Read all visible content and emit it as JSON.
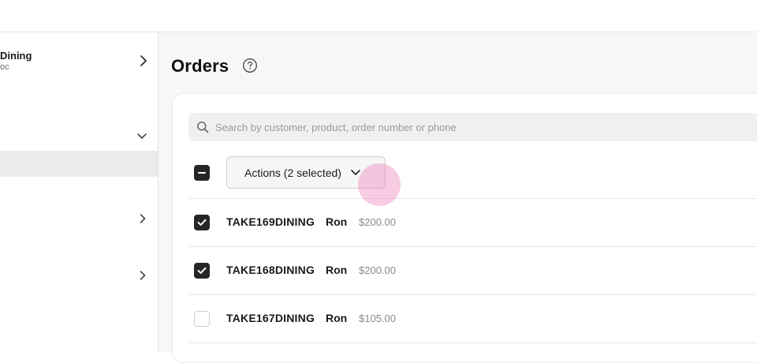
{
  "sidebar": {
    "store_name": "Dining",
    "store_sub": "oc"
  },
  "main": {
    "title": "Orders",
    "search": {
      "placeholder": "Search by customer, product, order number or phone",
      "value": ""
    },
    "actions_label": "Actions (2 selected)",
    "orders": [
      {
        "number": "TAKE169DINING",
        "customer": "Ron",
        "amount": "$200.00",
        "checked": true
      },
      {
        "number": "TAKE168DINING",
        "customer": "Ron",
        "amount": "$200.00",
        "checked": true
      },
      {
        "number": "TAKE167DINING",
        "customer": "Ron",
        "amount": "$105.00",
        "checked": false
      }
    ]
  },
  "icons": {
    "help": "question-circle-icon",
    "search": "search-icon",
    "chevron_right": "chevron-right-icon",
    "chevron_down": "chevron-down-icon",
    "check": "check-icon",
    "minus": "minus-icon"
  },
  "colors": {
    "checkbox_fill": "#262626",
    "active_nav_bg": "#ebebeb",
    "main_bg": "#f7f7f7",
    "click_highlight": "#ec78b2"
  }
}
